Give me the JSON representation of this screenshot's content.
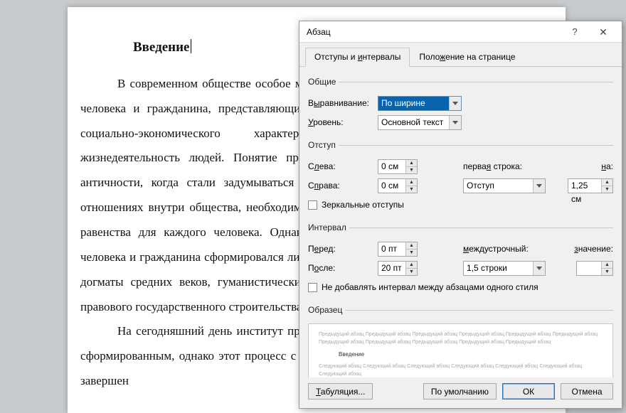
{
  "document": {
    "title": "Введение",
    "para1": "В современном обществе особое место уделяется соблюдению прав и свобод человека и гражданина, представляющие совокупность благ личного, правового, социально-экономического характера, обеспечивающие нормальную жизнедеятельность людей. Понятие прав человека появилось еще во времена античности, когда стали задумываться о морально-нравственных и социальных отношениях внутри общества, необходимости защиты этих прав, справедливости и равенства для каждого человека. Однако окончательно институт прав и свобод человека и гражданина сформировался лишь в XVIII веке, пройдя через религиозные догматы средних веков, гуманистические ценности эпохи возрождения, попытки правового государственного строительства.",
    "para2": "На сегодняшний день институт прав и свобод человека считается полностью сформированным, однако этот процесс с исторической точки зрения не может быть завершен"
  },
  "dialog": {
    "title": "Абзац",
    "tabs": {
      "t1_pre": "Отступы и ",
      "t1_u": "и",
      "t1_post": "нтервалы",
      "t2": "Поло",
      "t2_u": "ж",
      "t2_post": "ение на странице"
    },
    "general": {
      "legend": "Общие",
      "align_label_pre": "В",
      "align_label_u": "ы",
      "align_label_post": "равнивание:",
      "align_value": "По ширине",
      "level_label_pre": "",
      "level_label_u": "У",
      "level_label_post": "ровень:",
      "level_value": "Основной текст"
    },
    "indent": {
      "legend": "Отступ",
      "left_pre": "С",
      "left_u": "л",
      "left_post": "ева:",
      "left_value": "0 см",
      "right_pre": "С",
      "right_u": "п",
      "right_post": "рава:",
      "right_value": "0 см",
      "first_pre": "перва",
      "first_u": "я",
      "first_post": " строка:",
      "first_value": "Отступ",
      "by_pre": "",
      "by_u": "н",
      "by_post": "а:",
      "by_value": "1,25 см",
      "mirror_pre": "",
      "mirror_u": "З",
      "mirror_post": "еркальные отступы"
    },
    "spacing": {
      "legend": "Интервал",
      "before_pre": "П",
      "before_u": "е",
      "before_post": "ред:",
      "before_value": "0 пт",
      "after_pre": "П",
      "after_u": "о",
      "after_post": "сле:",
      "after_value": "20 пт",
      "line_pre": "",
      "line_u": "м",
      "line_post": "еждустрочный:",
      "line_value": "1,5 строки",
      "at_pre": "",
      "at_u": "з",
      "at_post": "начение:",
      "at_value": "",
      "nospace_pre": "Не добавлять интервал между абзацами одного стиля",
      "nospace_u": "",
      "nospace_post": ""
    },
    "preview": {
      "legend": "Образец",
      "prev_text": "Предыдущий абзац Предыдущий абзац Предыдущий абзац Предыдущий абзац Предыдущий абзац Предыдущий абзац Предыдущий абзац Предыдущий абзац Предыдущий абзац Предыдущий абзац Предыдущий абзац",
      "sample": "Введение",
      "next_text": "Следующий абзац Следующий абзац Следующий абзац Следующий абзац Следующий абзац Следующий абзац Следующий абзац"
    },
    "buttons": {
      "tabs_pre": "",
      "tabs_u": "Т",
      "tabs_post": "абуляция...",
      "default": "По умолчанию",
      "ok": "ОК",
      "cancel": "Отмена"
    }
  }
}
